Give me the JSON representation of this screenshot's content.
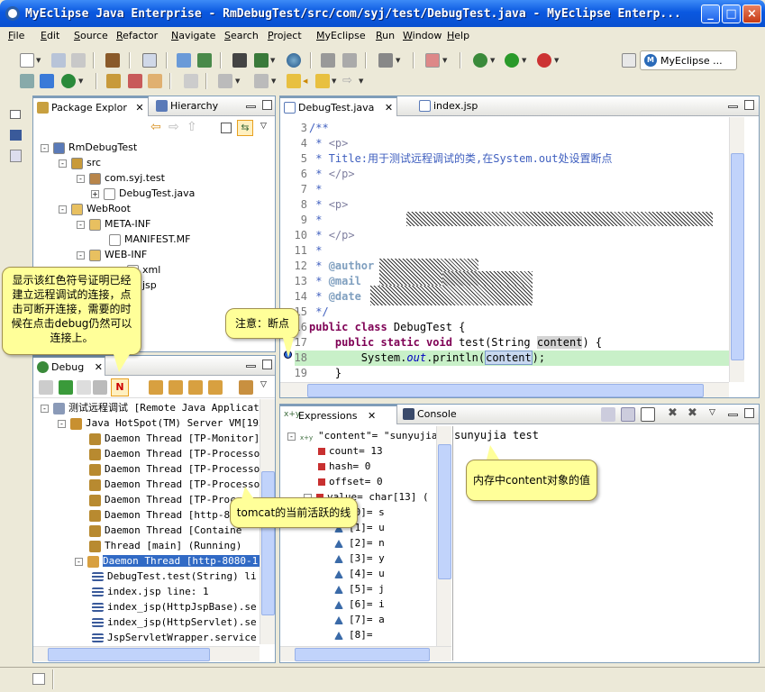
{
  "window": {
    "title": "MyEclipse Java Enterprise - RmDebugTest/src/com/syj/test/DebugTest.java - MyEclipse Enterp...",
    "min_label": "_",
    "max_label": "□",
    "close_label": "×"
  },
  "menu": [
    "File",
    "Edit",
    "Source",
    "Refactor",
    "Navigate",
    "Search",
    "Project",
    "MyEclipse",
    "Run",
    "Window",
    "Help"
  ],
  "perspective": {
    "label": "MyEclipse ..."
  },
  "package_explorer": {
    "tabs": [
      "Package Explor",
      "Hierarchy"
    ],
    "tree": [
      {
        "text": "RmDebugTest",
        "expander": "-"
      },
      {
        "text": "src",
        "expander": "-"
      },
      {
        "text": "com.syj.test",
        "expander": "-"
      },
      {
        "text": "DebugTest.java",
        "expander": "+"
      },
      {
        "text": "WebRoot",
        "expander": "-"
      },
      {
        "text": "META-INF",
        "expander": "-"
      },
      {
        "text": "MANIFEST.MF",
        "expander": ""
      },
      {
        "text": "WEB-INF",
        "expander": "-"
      },
      {
        "text": "xml",
        "expander": ""
      },
      {
        "text": "jsp",
        "expander": ""
      }
    ]
  },
  "editor": {
    "tabs": [
      "DebugTest.java",
      "index.jsp"
    ],
    "lines": [
      {
        "n": "3",
        "html": "<span class='cmt'>/**</span>"
      },
      {
        "n": "4",
        "html": "<span class='cmt'> * </span><span class='tag'>&lt;p&gt;</span>"
      },
      {
        "n": "5",
        "html": "<span class='cmt'> * Title:用于测试远程调试的类,在System.out处设置断点</span>"
      },
      {
        "n": "6",
        "html": "<span class='cmt'> * </span><span class='tag'>&lt;/p&gt;</span>"
      },
      {
        "n": "7",
        "html": "<span class='cmt'> *</span>"
      },
      {
        "n": "8",
        "html": "<span class='cmt'> * </span><span class='tag'>&lt;p&gt;</span>"
      },
      {
        "n": "9",
        "html": "<span class='cmt'> *</span>"
      },
      {
        "n": "10",
        "html": "<span class='cmt'> * </span><span class='tag'>&lt;/p&gt;</span>"
      },
      {
        "n": "11",
        "html": "<span class='cmt'> *</span>"
      },
      {
        "n": "12",
        "html": "<span class='cmt'> * <b style='color:#7f9fbf'>@author</b></span>"
      },
      {
        "n": "13",
        "html": "<span class='cmt'> * <b style='color:#7f9fbf'>@mail</b></span>"
      },
      {
        "n": "14",
        "html": "<span class='cmt'> * <b style='color:#7f9fbf'>@date</b></span>"
      },
      {
        "n": "15",
        "html": "<span class='cmt'> */</span>"
      },
      {
        "n": "16",
        "html": "<span class='kw'>public class</span> DebugTest {"
      },
      {
        "n": "17",
        "html": "    <span class='kw'>public static void</span> test(String <span style='background:#d4d4d4'>content</span>) {"
      },
      {
        "n": "18",
        "html": "        System.<span class='ital'>out</span>.println(<span style='background:#c8d8f0;border:1px solid #7a9ac8'>content</span>);"
      },
      {
        "n": "19",
        "html": "    }"
      }
    ]
  },
  "debug": {
    "tab": "Debug",
    "tree": [
      {
        "text": "测试远程调试 [Remote Java Applicat:",
        "expander": "-",
        "indent": 0,
        "icon": "launch"
      },
      {
        "text": "Java HotSpot(TM) Server VM[192.",
        "expander": "-",
        "indent": 1,
        "icon": "vm"
      },
      {
        "text": "Daemon Thread [TP-Monitor] (",
        "expander": "",
        "indent": 2,
        "icon": "thread"
      },
      {
        "text": "Daemon Thread [TP-Processor4",
        "expander": "",
        "indent": 2,
        "icon": "thread"
      },
      {
        "text": "Daemon Thread [TP-Processor3",
        "expander": "",
        "indent": 2,
        "icon": "thread"
      },
      {
        "text": "Daemon Thread [TP-Processor2",
        "expander": "",
        "indent": 2,
        "icon": "thread"
      },
      {
        "text": "Daemon Thread [TP-Process",
        "expander": "",
        "indent": 2,
        "icon": "thread"
      },
      {
        "text": "Daemon Thread [http-808",
        "expander": "",
        "indent": 2,
        "icon": "thread"
      },
      {
        "text": "Daemon Thread [Containe",
        "expander": "",
        "indent": 2,
        "icon": "thread"
      },
      {
        "text": "Thread [main] (Running)",
        "expander": "",
        "indent": 2,
        "icon": "thread"
      },
      {
        "text": "Daemon Thread [http-8080-1]",
        "expander": "-",
        "indent": 2,
        "icon": "suspended",
        "selected": true
      },
      {
        "text": "DebugTest.test(String) li",
        "expander": "",
        "indent": 3,
        "icon": "frame"
      },
      {
        "text": "index.jsp line: 1",
        "expander": "",
        "indent": 3,
        "icon": "frame"
      },
      {
        "text": "index_jsp(HttpJspBase).se",
        "expander": "",
        "indent": 3,
        "icon": "frame"
      },
      {
        "text": "index_jsp(HttpServlet).se",
        "expander": "",
        "indent": 3,
        "icon": "frame"
      },
      {
        "text": "JspServletWrapper.service",
        "expander": "",
        "indent": 3,
        "icon": "frame"
      }
    ]
  },
  "expressions": {
    "tabs": [
      "Expressions",
      "Console"
    ],
    "tree": [
      {
        "text": "\"content\"= \"sunyujia",
        "expander": "-",
        "indent": 0,
        "icon": "expr"
      },
      {
        "text": "count= 13",
        "expander": "",
        "indent": 1,
        "icon": "field-f"
      },
      {
        "text": "hash= 0",
        "expander": "",
        "indent": 1,
        "icon": "field"
      },
      {
        "text": "offset= 0",
        "expander": "",
        "indent": 1,
        "icon": "field-f"
      },
      {
        "text": "value= char[13]  (",
        "expander": "-",
        "indent": 1,
        "icon": "field"
      },
      {
        "text": "[0]= s",
        "expander": "",
        "indent": 2,
        "icon": "tri"
      },
      {
        "text": "[1]= u",
        "expander": "",
        "indent": 2,
        "icon": "tri"
      },
      {
        "text": "[2]= n",
        "expander": "",
        "indent": 2,
        "icon": "tri"
      },
      {
        "text": "[3]= y",
        "expander": "",
        "indent": 2,
        "icon": "tri"
      },
      {
        "text": "[4]= u",
        "expander": "",
        "indent": 2,
        "icon": "tri"
      },
      {
        "text": "[5]= j",
        "expander": "",
        "indent": 2,
        "icon": "tri"
      },
      {
        "text": "[6]= i",
        "expander": "",
        "indent": 2,
        "icon": "tri"
      },
      {
        "text": "[7]= a",
        "expander": "",
        "indent": 2,
        "icon": "tri"
      },
      {
        "text": "[8]=",
        "expander": "",
        "indent": 2,
        "icon": "tri"
      }
    ],
    "detail": "sunyujia test"
  },
  "callouts": {
    "remote": "显示该红色符号证明已经建立远程调试的连接，点击可断开连接，需要的时候在点击debug仍然可以连接上。",
    "breakpoint": "注意：断点",
    "threads": "tomcat的当前活跃的线",
    "memory": "内存中content对象的值"
  }
}
